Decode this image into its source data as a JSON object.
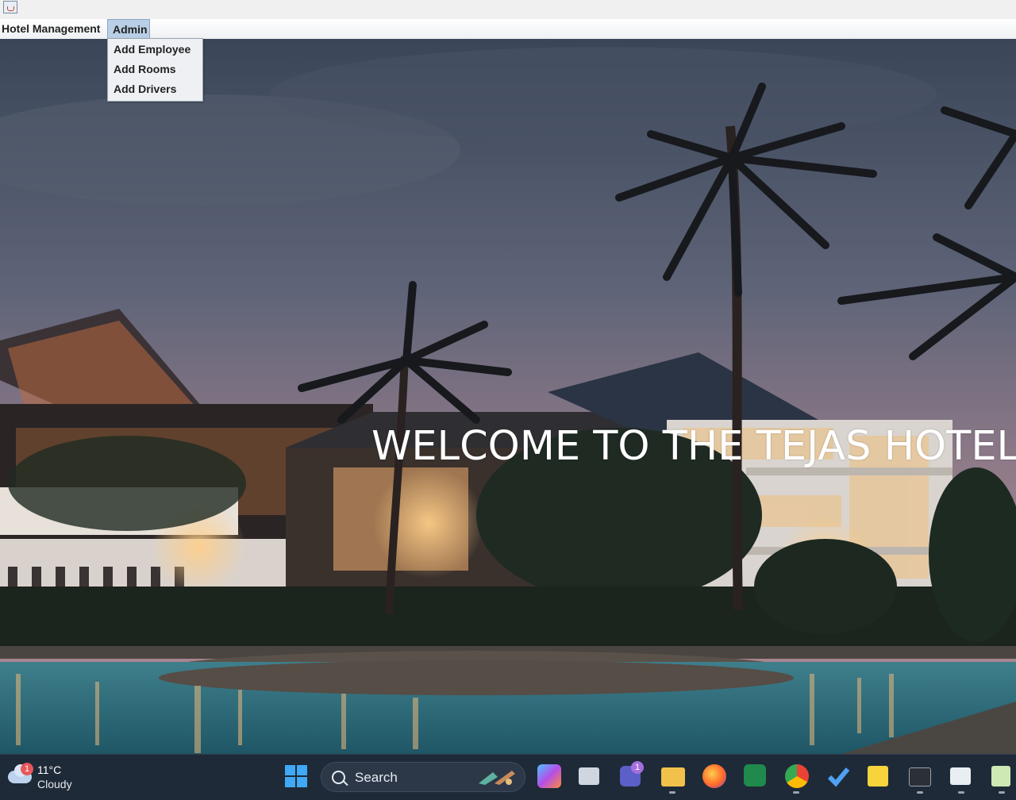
{
  "menubar": {
    "hotel_menu": "Hotel Management",
    "admin_menu": "Admin"
  },
  "admin_dropdown": {
    "items": [
      "Add Employee",
      "Add Rooms",
      "Add Drivers"
    ]
  },
  "main": {
    "welcome_text": "WELCOME TO THE TEJAS HOTEL"
  },
  "taskbar": {
    "weather_temp": "11°C",
    "weather_condition": "Cloudy",
    "weather_badge": "1",
    "search_label": "Search",
    "teams_badge": "1",
    "apps": [
      "copilot-icon",
      "task-view-icon",
      "teams-icon",
      "file-explorer-icon",
      "firefox-icon",
      "excel-icon",
      "chrome-icon",
      "todo-icon",
      "sticky-notes-icon",
      "terminal-icon",
      "window-icon",
      "notepad-icon"
    ]
  }
}
